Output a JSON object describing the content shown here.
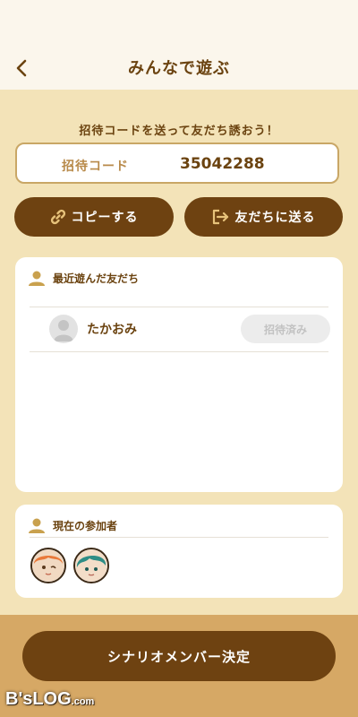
{
  "header": {
    "title": "みんなで遊ぶ",
    "back_icon": "chevron-left-icon"
  },
  "invite": {
    "prompt": "招待コードを送って友だち誘おう！",
    "code_label": "招待コード",
    "code_value": "35042288"
  },
  "actions": {
    "copy_label": "コピーする",
    "copy_icon": "link-icon",
    "send_label": "友だちに送る",
    "send_icon": "share-exit-icon"
  },
  "recent_friends": {
    "heading": "最近遊んだ友だち",
    "items": [
      {
        "name": "たかおみ",
        "status": "招待済み"
      }
    ]
  },
  "participants": {
    "heading": "現在の参加者",
    "members": [
      {
        "icon": "orange-hair-character-avatar"
      },
      {
        "icon": "teal-hair-character-avatar"
      }
    ]
  },
  "footer": {
    "decide_label": "シナリオメンバー決定"
  },
  "watermark": {
    "brand": "B'sLOG",
    "suffix": ".com"
  },
  "colors": {
    "accent_brown": "#6e4211",
    "background": "#f3e3b8",
    "footer": "#d6a865",
    "text": "#6b4310"
  }
}
